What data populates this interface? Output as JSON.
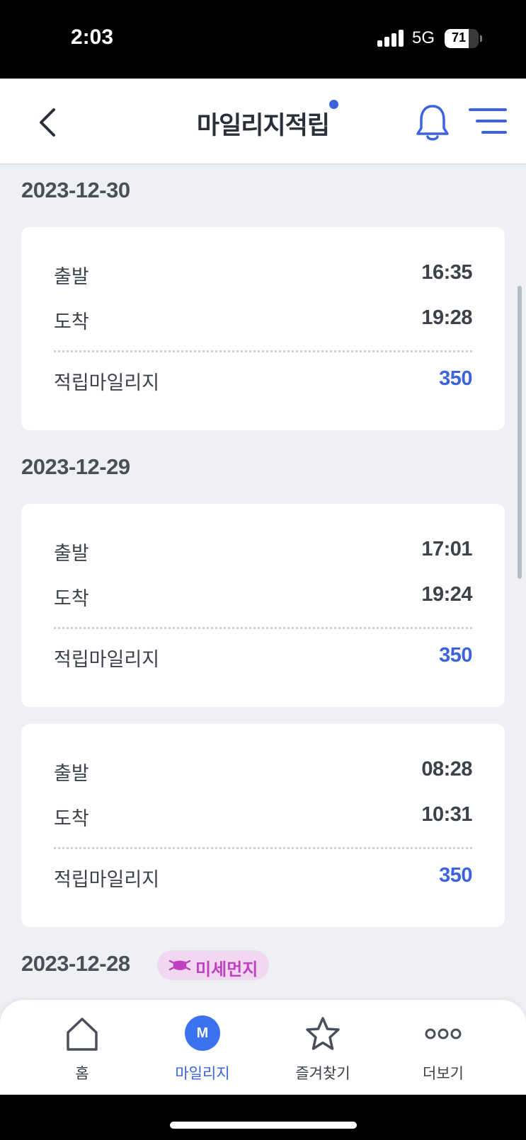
{
  "status_bar": {
    "time": "2:03",
    "network": "5G",
    "battery": "71",
    "battery_level": 0.71
  },
  "header": {
    "title": "마일리지적립",
    "back_icon": "chevron-left-icon",
    "bell_icon": "bell-icon",
    "menu_icon": "menu-icon",
    "accent_color": "#3b63e0"
  },
  "days": [
    {
      "date": "2023-12-30",
      "trips": [
        {
          "depart_label": "출발",
          "depart": "16:35",
          "arrive_label": "도착",
          "arrive": "19:28",
          "mileage_label": "적립마일리지",
          "mileage": "350"
        }
      ]
    },
    {
      "date": "2023-12-29",
      "trips": [
        {
          "depart_label": "출발",
          "depart": "17:01",
          "arrive_label": "도착",
          "arrive": "19:24",
          "mileage_label": "적립마일리지",
          "mileage": "350"
        },
        {
          "depart_label": "출발",
          "depart": "08:28",
          "arrive_label": "도착",
          "arrive": "10:31",
          "mileage_label": "적립마일리지",
          "mileage": "350"
        }
      ]
    },
    {
      "date": "2023-12-28",
      "badge": "미세먼지",
      "badge_icon": "mask-icon",
      "trips": []
    }
  ],
  "bottom_nav": [
    {
      "label": "홈",
      "icon": "home-icon",
      "active": false
    },
    {
      "label": "마일리지",
      "icon": "mileage-icon",
      "icon_text": "M",
      "active": true
    },
    {
      "label": "즐겨찾기",
      "icon": "star-icon",
      "active": false
    },
    {
      "label": "더보기",
      "icon": "more-icon",
      "active": false
    }
  ]
}
